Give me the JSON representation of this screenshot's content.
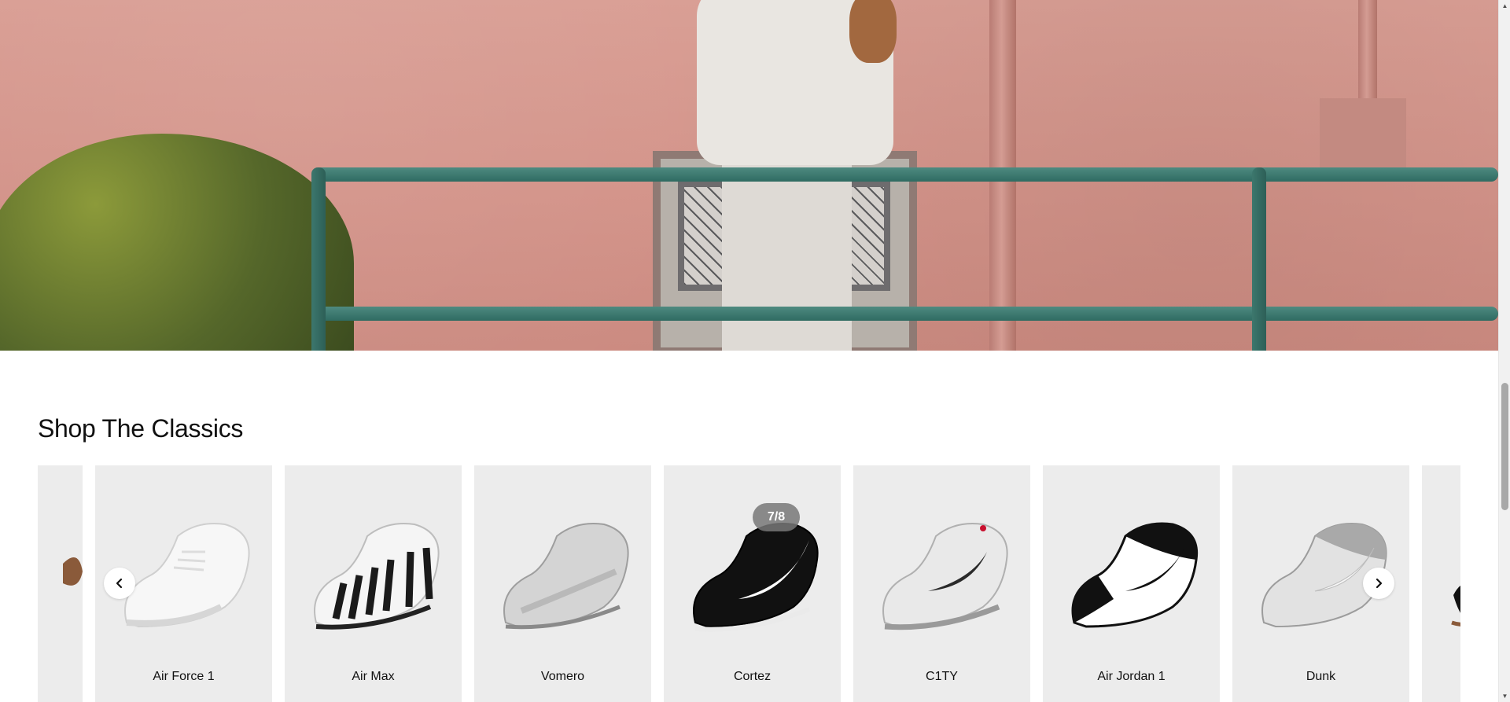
{
  "hero": {
    "alt": "Model in white sweatsuit leaning on a green railing in front of a pink wall"
  },
  "section": {
    "title": "Shop The Classics"
  },
  "carousel": {
    "counter": "7/8",
    "prev_icon": "chevron-left-icon",
    "next_icon": "chevron-right-icon",
    "cards": [
      {
        "label": "",
        "shoe_style": "partial-brown"
      },
      {
        "label": "Air Force 1",
        "shoe_style": "white-low"
      },
      {
        "label": "Air Max",
        "shoe_style": "white-black-stripes"
      },
      {
        "label": "Vomero",
        "shoe_style": "silver-runner"
      },
      {
        "label": "Cortez",
        "shoe_style": "black-white-swoosh"
      },
      {
        "label": "C1TY",
        "shoe_style": "white-grey-black"
      },
      {
        "label": "Air Jordan 1",
        "shoe_style": "black-white-panda"
      },
      {
        "label": "Dunk",
        "shoe_style": "grey-white"
      },
      {
        "label": "",
        "shoe_style": "partial-black"
      }
    ]
  },
  "colors": {
    "card_bg": "#ececec",
    "rail_green": "#2f6b62",
    "wall_pink": "#d39389"
  }
}
